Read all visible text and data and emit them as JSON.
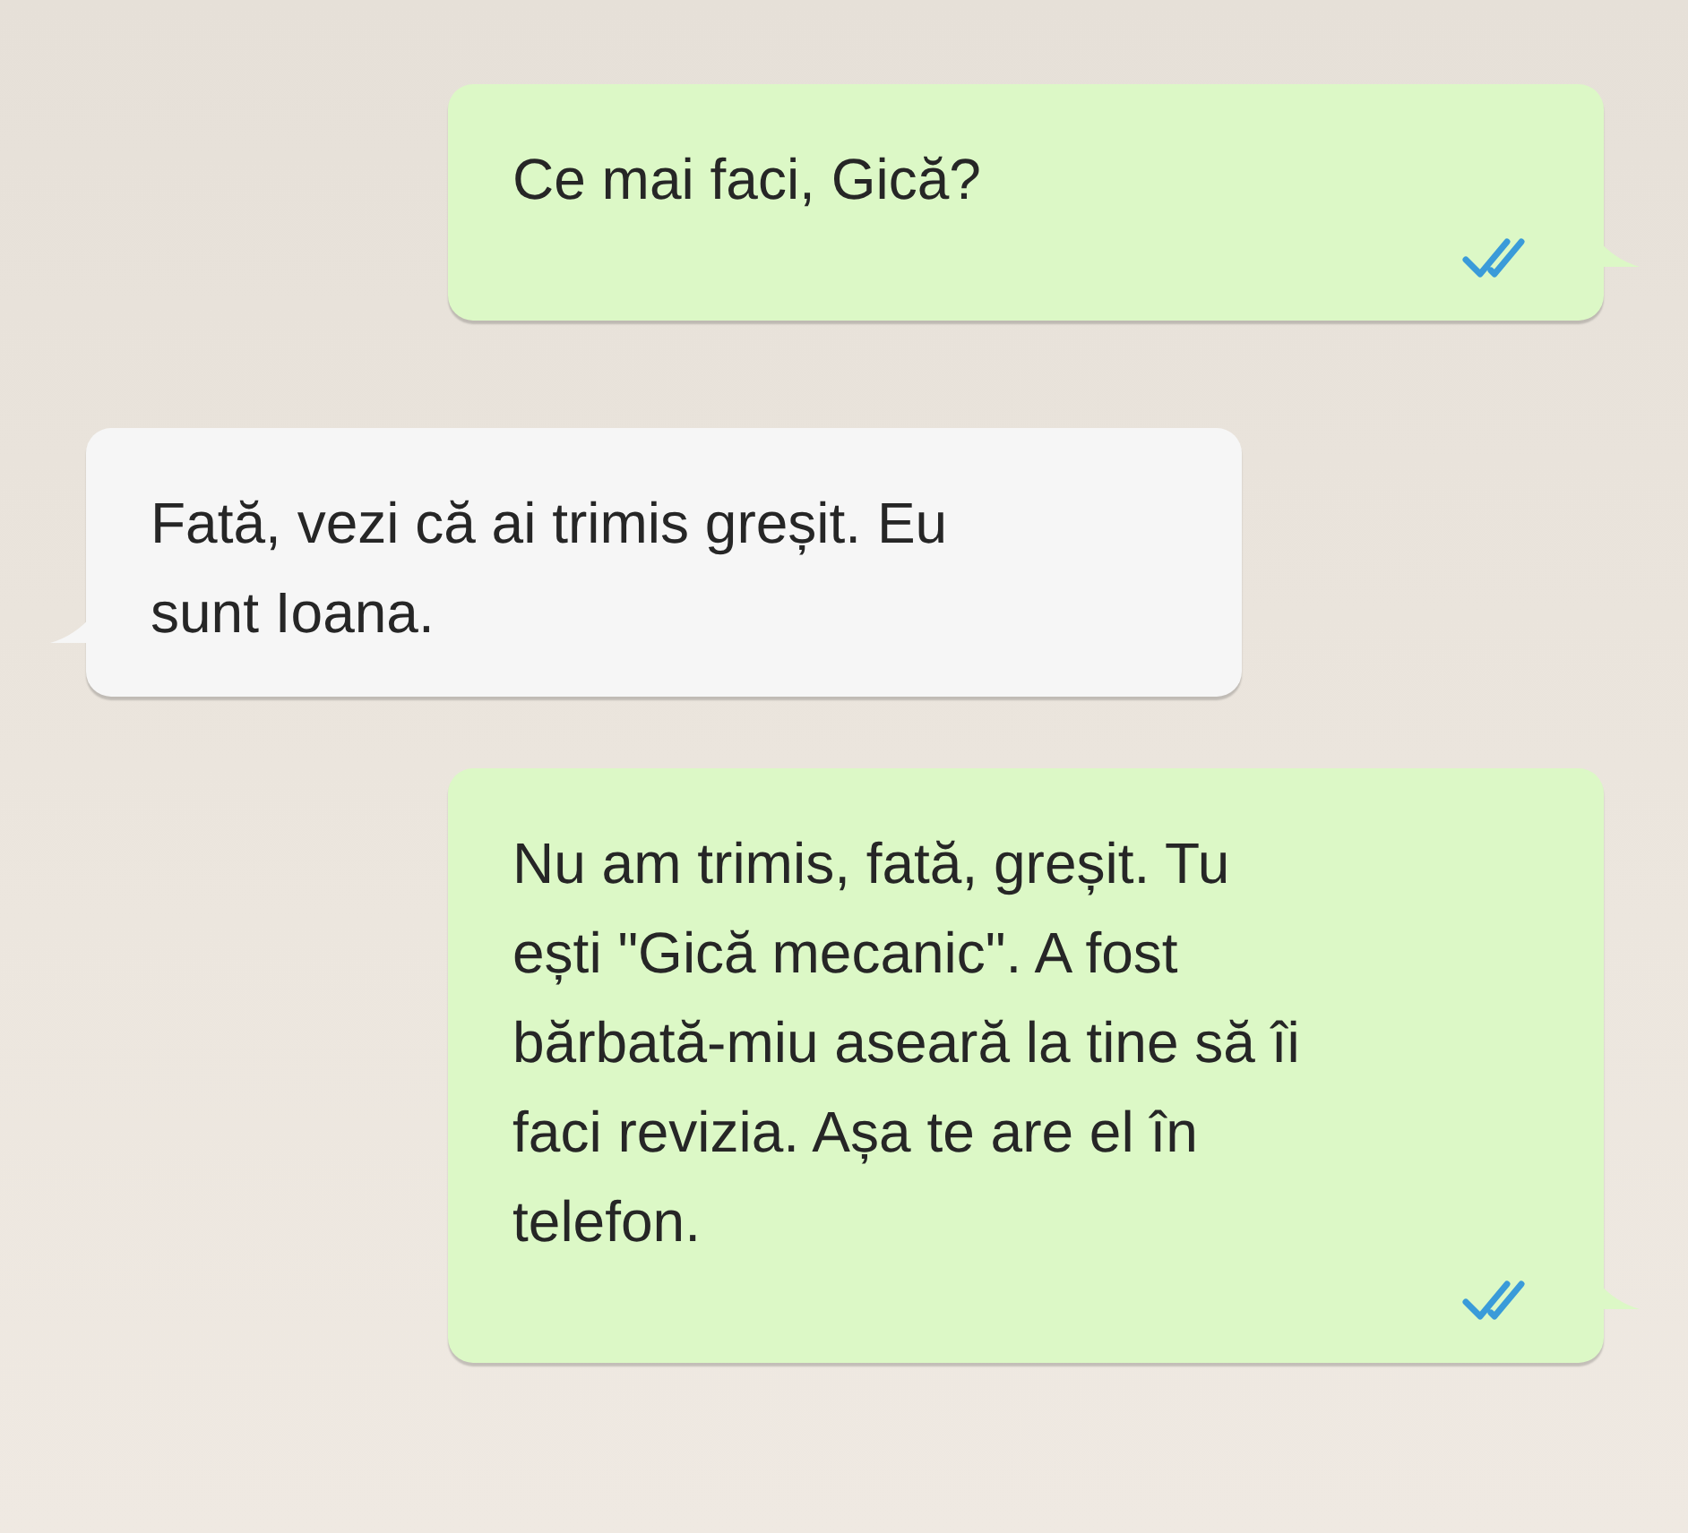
{
  "messages": [
    {
      "kind": "outgoing",
      "lines": [
        "Ce mai faci, Gică?"
      ],
      "read": true
    },
    {
      "kind": "incoming",
      "lines": [
        "Fată, vezi că ai trimis greșit. Eu",
        "sunt Ioana."
      ]
    },
    {
      "kind": "outgoing",
      "lines": [
        "Nu am trimis, fată, greșit. Tu",
        "ești \"Gică mecanic\". A fost",
        "bărbată-miu aseară la tine să îi",
        "faci revizia. Așa te are el în",
        "telefon."
      ],
      "read": true
    }
  ]
}
